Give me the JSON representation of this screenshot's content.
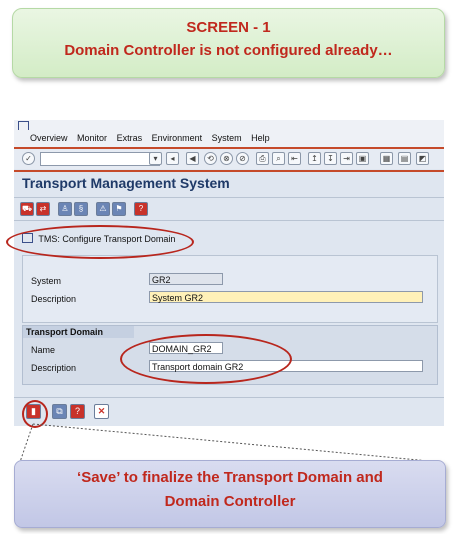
{
  "callout_top": {
    "line1": "SCREEN - 1",
    "line2": "Domain Controller is not configured already…"
  },
  "menu": [
    "Overview",
    "Monitor",
    "Extras",
    "Environment",
    "System",
    "Help"
  ],
  "window_title": "Transport Management System",
  "dialog_title": "TMS: Configure Transport Domain",
  "system": {
    "label": "System",
    "value": "GR2",
    "desc_label": "Description",
    "desc_value": "System GR2"
  },
  "transport_domain": {
    "group_label": "Transport Domain",
    "name_label": "Name",
    "name_value": "DOMAIN_GR2",
    "desc_label": "Description",
    "desc_value": "Transport domain GR2"
  },
  "callout_bottom": {
    "line1": "‘Save’ to finalize the Transport Domain and",
    "line2": "Domain Controller"
  },
  "icons": {
    "toolbar": [
      "enter-icon",
      "save-icon",
      "back-icon",
      "exit-icon",
      "cancel-icon",
      "print-icon",
      "find-icon",
      "find-next-icon",
      "first-page-icon",
      "prev-page-icon",
      "next-page-icon",
      "last-page-icon",
      "create-session-icon",
      "shortcut-icon",
      "help-icon"
    ],
    "bottom": [
      "save-icon",
      "copy-icon",
      "help-icon",
      "cancel-icon"
    ]
  },
  "colors": {
    "accent_red": "#c0281d",
    "sap_title": "#1f3a68",
    "highlight_ellipse": "#b8261d"
  }
}
